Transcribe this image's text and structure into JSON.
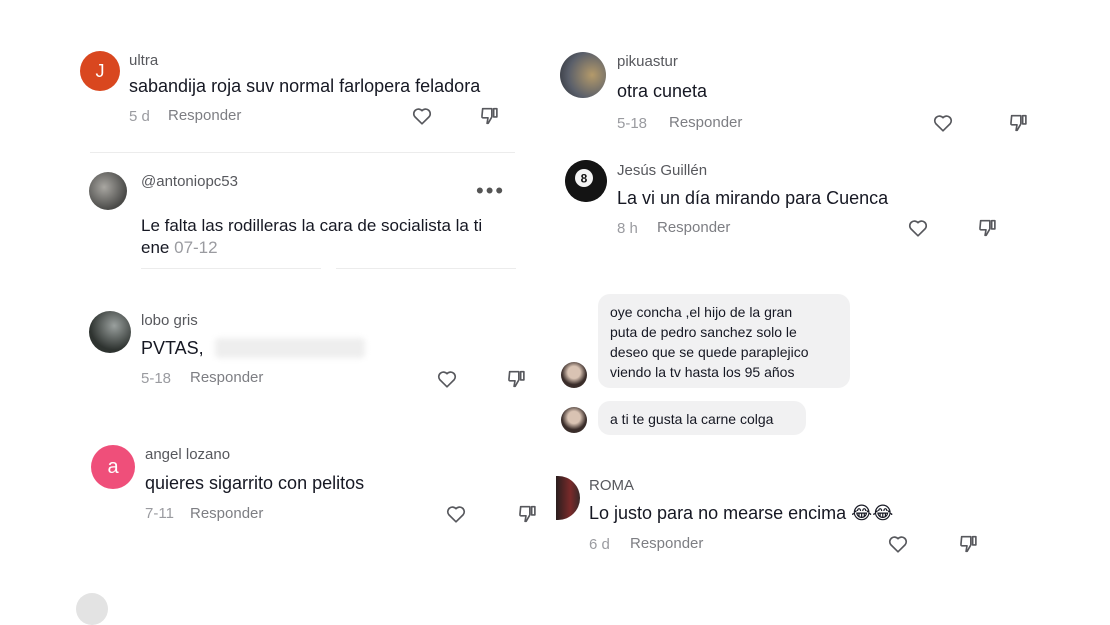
{
  "actions": {
    "reply_label": "Responder"
  },
  "comments_left": [
    {
      "username": "ultra",
      "avatar_letter": "J",
      "avatar_color": "#d9471f",
      "text": "sabandija roja suv normal farlopera feladora",
      "time": "5 d"
    },
    {
      "username": "@antoniopc53",
      "text_line1": "Le falta las rodilleras la cara de socialista la ti",
      "text_line2": "ene",
      "inline_date": "07-12"
    },
    {
      "username": "lobo gris",
      "text": "PVTAS,",
      "time": "5-18"
    },
    {
      "username": "angel lozano",
      "avatar_letter": "a",
      "avatar_color": "#ef4f7a",
      "text": "quieres sigarrito con pelitos",
      "time": "7-11"
    }
  ],
  "comments_right": [
    {
      "username": "pikuastur",
      "text": "otra cuneta",
      "time": "5-18"
    },
    {
      "username": "Jesús Guillén",
      "text": "La vi un día mirando para Cuenca",
      "time": "8 h"
    },
    {
      "username": "ROMA",
      "text": "Lo justo para no mearse encima",
      "emoji": "😂😂",
      "time": "6 d"
    }
  ],
  "messages": [
    {
      "lines": [
        "oye concha ,el hijo de la gran",
        "puta de pedro sanchez solo le",
        "deseo que se quede paraplejico",
        "viendo la tv hasta los 95 años"
      ]
    },
    {
      "lines": [
        "a ti te gusta la carne colga"
      ]
    }
  ],
  "colors": {
    "text": "#161823",
    "muted": "#9a9ba0",
    "bubble": "#f1f1f2"
  }
}
